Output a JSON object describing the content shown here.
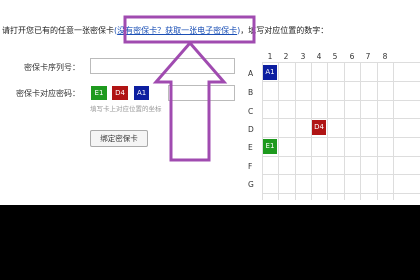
{
  "instruction": {
    "prefix": "请打开您已有的任意一张密保卡",
    "paren_open": "(",
    "link_text": "没有密保卡？获取一张电子密保卡",
    "paren_close": ")",
    "suffix": "，填写对应位置的数字："
  },
  "form": {
    "serial_label": "密保卡序列号：",
    "code_label": "密保卡对应密码：",
    "serial_value": "",
    "code_value": "",
    "chips": [
      "E1",
      "D4",
      "A1"
    ],
    "hint": "填写卡上对应位置的坐标",
    "bind_button": "绑定密保卡"
  },
  "grid": {
    "columns": [
      "1",
      "2",
      "3",
      "4",
      "5",
      "6",
      "7",
      "8"
    ],
    "rows": [
      "A",
      "B",
      "C",
      "D",
      "E",
      "F",
      "G"
    ],
    "highlights": [
      {
        "label": "A1",
        "row": "A",
        "col": "1",
        "color": "#0d1fa0"
      },
      {
        "label": "D4",
        "row": "D",
        "col": "4",
        "color": "#b01414"
      },
      {
        "label": "E1",
        "row": "E",
        "col": "1",
        "color": "#1e9a1e"
      }
    ]
  },
  "colors": {
    "link": "#1a4fb5",
    "annotation_arrow": "#a04bb0",
    "chip_green": "#1e9a1e",
    "chip_red": "#b01414",
    "chip_blue": "#0d1fa0"
  },
  "annotation": {
    "icon": "arrow-up-icon"
  }
}
